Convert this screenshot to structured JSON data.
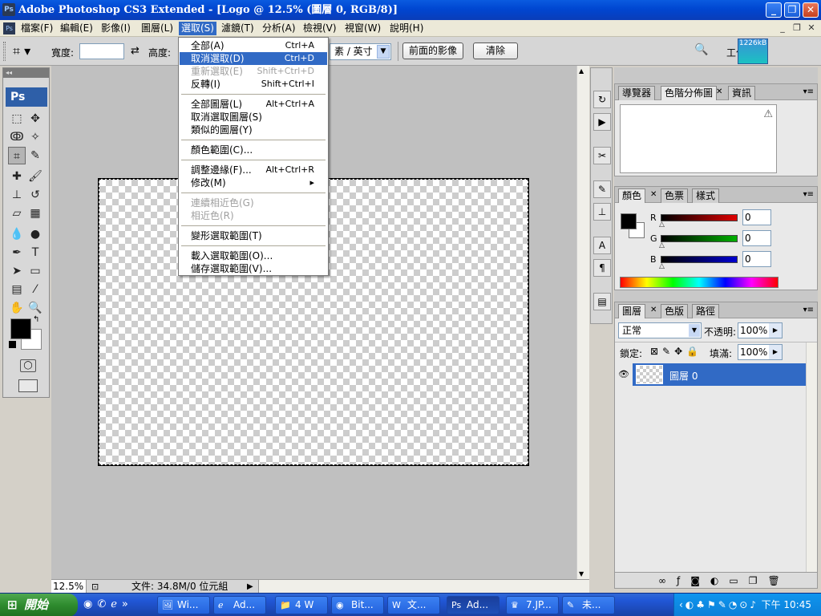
{
  "window": {
    "app_icon": "Ps",
    "title": "Adobe Photoshop CS3 Extended - [Logo @ 12.5% (圖層 0, RGB/8)]",
    "minimize": "_",
    "restore": "❐",
    "close": "✕"
  },
  "menubar": {
    "items": [
      "檔案(F)",
      "編輯(E)",
      "影像(I)",
      "圖層(L)",
      "選取(S)",
      "濾鏡(T)",
      "分析(A)",
      "檢視(V)",
      "視窗(W)",
      "說明(H)"
    ],
    "active_index": 4
  },
  "options_bar": {
    "width_label": "寬度:",
    "width_value": "",
    "height_label": "高度:",
    "resolution_unit": "素 / 英寸",
    "front_image_button": "前面的影像",
    "clear_button": "清除",
    "workspace_label": "工作",
    "memory_readout": "1226kB"
  },
  "select_menu": {
    "items": [
      {
        "label": "全部(A)",
        "shortcut": "Ctrl+A",
        "state": "normal"
      },
      {
        "label": "取消選取(D)",
        "shortcut": "Ctrl+D",
        "state": "highlighted"
      },
      {
        "label": "重新選取(E)",
        "shortcut": "Shift+Ctrl+D",
        "state": "disabled"
      },
      {
        "label": "反轉(I)",
        "shortcut": "Shift+Ctrl+I",
        "state": "normal"
      },
      {
        "label": "全部圖層(L)",
        "shortcut": "Alt+Ctrl+A",
        "state": "normal"
      },
      {
        "label": "取消選取圖層(S)",
        "shortcut": "",
        "state": "normal"
      },
      {
        "label": "類似的圖層(Y)",
        "shortcut": "",
        "state": "normal"
      },
      {
        "label": "顏色範圍(C)...",
        "shortcut": "",
        "state": "normal"
      },
      {
        "label": "調整邊緣(F)...",
        "shortcut": "Alt+Ctrl+R",
        "state": "normal"
      },
      {
        "label": "修改(M)",
        "shortcut": "",
        "state": "submenu"
      },
      {
        "label": "連續相近色(G)",
        "shortcut": "",
        "state": "disabled"
      },
      {
        "label": "相近色(R)",
        "shortcut": "",
        "state": "disabled"
      },
      {
        "label": "變形選取範圍(T)",
        "shortcut": "",
        "state": "normal"
      },
      {
        "label": "載入選取範圍(O)...",
        "shortcut": "",
        "state": "normal"
      },
      {
        "label": "儲存選取範圍(V)...",
        "shortcut": "",
        "state": "normal"
      }
    ],
    "submenu_arrow": "▸"
  },
  "toolbox": {
    "logo": "Ps",
    "tools": [
      {
        "name": "marquee-tool-icon",
        "glyph": "⬚"
      },
      {
        "name": "move-tool-icon",
        "glyph": "✥"
      },
      {
        "name": "lasso-tool-icon",
        "glyph": "ↂ"
      },
      {
        "name": "magic-wand-tool-icon",
        "glyph": "✧"
      },
      {
        "name": "crop-tool-icon",
        "glyph": "⌗"
      },
      {
        "name": "slice-tool-icon",
        "glyph": "✎"
      },
      {
        "name": "healing-brush-tool-icon",
        "glyph": "✚"
      },
      {
        "name": "brush-tool-icon",
        "glyph": "🖌"
      },
      {
        "name": "clone-stamp-tool-icon",
        "glyph": "⊥"
      },
      {
        "name": "history-brush-tool-icon",
        "glyph": "↺"
      },
      {
        "name": "eraser-tool-icon",
        "glyph": "▱"
      },
      {
        "name": "gradient-tool-icon",
        "glyph": "▦"
      },
      {
        "name": "blur-tool-icon",
        "glyph": "💧"
      },
      {
        "name": "dodge-tool-icon",
        "glyph": "●"
      },
      {
        "name": "pen-tool-icon",
        "glyph": "✒"
      },
      {
        "name": "type-tool-icon",
        "glyph": "T"
      },
      {
        "name": "path-selection-tool-icon",
        "glyph": "➤"
      },
      {
        "name": "rectangle-tool-icon",
        "glyph": "▭"
      },
      {
        "name": "notes-tool-icon",
        "glyph": "▤"
      },
      {
        "name": "eyedropper-tool-icon",
        "glyph": "⁄"
      },
      {
        "name": "hand-tool-icon",
        "glyph": "✋"
      },
      {
        "name": "zoom-tool-icon",
        "glyph": "🔍"
      }
    ],
    "foreground_color": "#000000",
    "background_color": "#ffffff"
  },
  "document": {
    "zoom": "12.5%",
    "file_info": "文件: 34.8M/0 位元組"
  },
  "navigator_panel": {
    "tabs": [
      "導覽器",
      "色階分佈圖",
      "資訊"
    ],
    "active_tab": 1,
    "warning_icon": "⚠"
  },
  "color_panel": {
    "tabs": [
      "顏色",
      "色票",
      "樣式"
    ],
    "active_tab": 0,
    "channels": [
      {
        "label": "R",
        "value": "0",
        "color": "#e00000"
      },
      {
        "label": "G",
        "value": "0",
        "color": "#00b000"
      },
      {
        "label": "B",
        "value": "0",
        "color": "#0000d0"
      }
    ]
  },
  "layers_panel": {
    "tabs": [
      "圖層",
      "色版",
      "路徑"
    ],
    "active_tab": 0,
    "blend_mode": "正常",
    "opacity_label": "不透明:",
    "opacity_value": "100%",
    "lock_label": "鎖定:",
    "fill_label": "填滿:",
    "fill_value": "100%",
    "layers": [
      {
        "name": "圖層 0",
        "visible": true,
        "selected": true
      }
    ]
  },
  "taskbar": {
    "start_label": "開始",
    "buttons": [
      "Wi...",
      "Ad...",
      "4 W",
      "Bit...",
      "文...",
      "Ad...",
      "7.JP...",
      "未..."
    ],
    "active_index": 5,
    "clock": "下午 10:45"
  }
}
